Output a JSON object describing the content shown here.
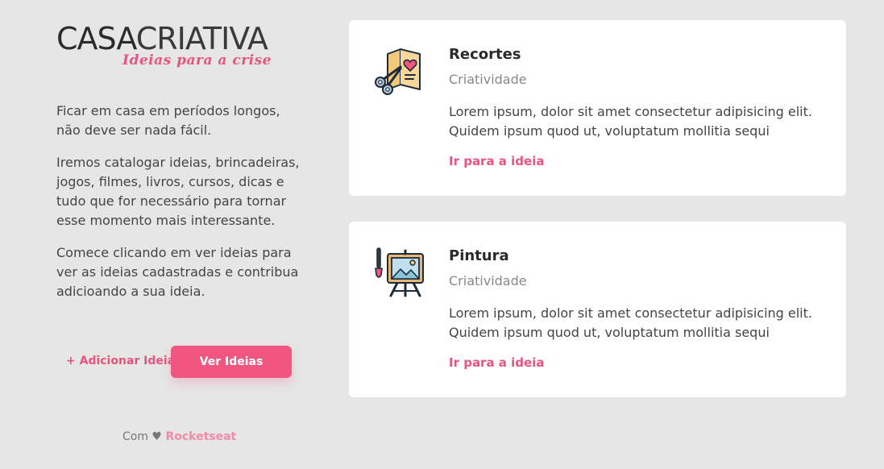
{
  "brand": {
    "logo_bold": "CASA",
    "logo_light": "CRIATIVA",
    "tagline": "Ideias para a crise"
  },
  "intro": {
    "paragraphs": [
      "Ficar em casa em períodos longos, não deve ser nada fácil.",
      "Iremos catalogar ideias, brincadeiras, jogos, filmes, livros, cursos, dicas e tudo que for necessário para tornar esse momento mais interessante.",
      "Comece clicando em ver ideias para ver as ideias cadastradas e contribua adicioando a sua ideia."
    ]
  },
  "actions": {
    "add_label": "+ Adicionar Ideia",
    "view_label": "Ver Ideias"
  },
  "footer": {
    "prefix": "Com ♥",
    "brand": "Rocketseat"
  },
  "ideas": [
    {
      "icon": "scissors-card-icon",
      "title": "Recortes",
      "category": "Criatividade",
      "description": "Lorem ipsum, dolor sit amet consectetur adipisicing elit. Quidem ipsum quod ut, voluptatum mollitia sequi",
      "link_label": "Ir para a ideia"
    },
    {
      "icon": "easel-painting-icon",
      "title": "Pintura",
      "category": "Criatividade",
      "description": "Lorem ipsum, dolor sit amet consectetur adipisicing elit. Quidem ipsum quod ut, voluptatum mollitia sequi",
      "link_label": "Ir para a ideia"
    }
  ],
  "colors": {
    "background": "#e6e6e6",
    "accent": "#f0567f",
    "card": "#ffffff"
  }
}
